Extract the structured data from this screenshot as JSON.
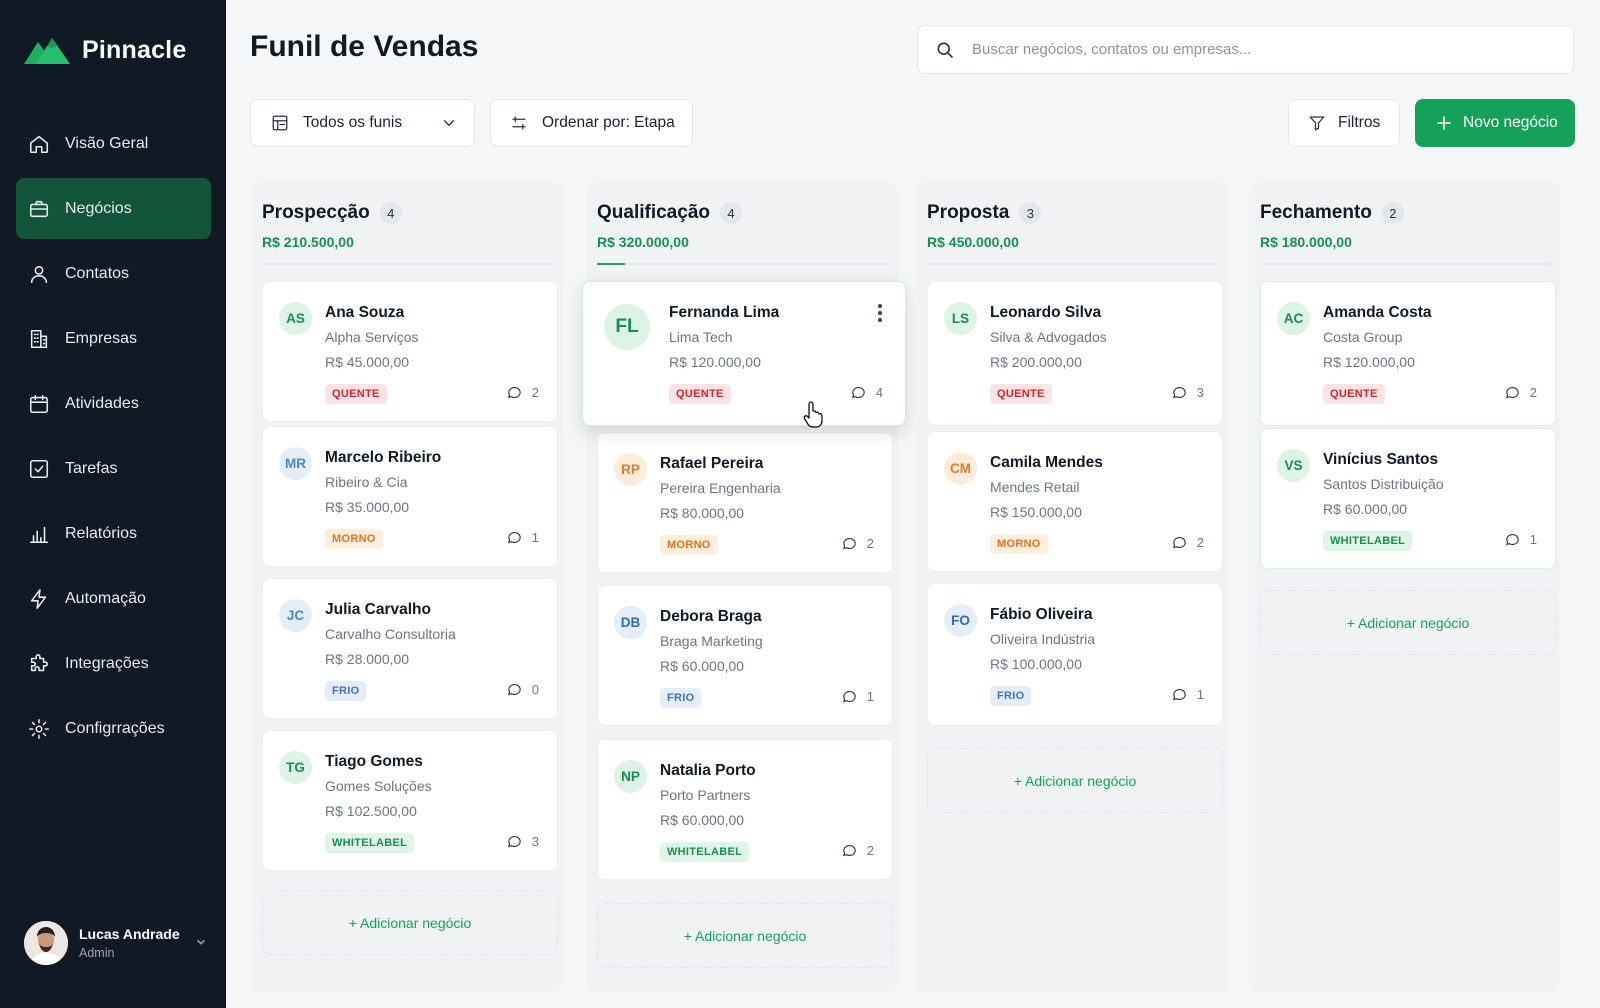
{
  "app": {
    "name": "Pinnacle",
    "brand_color": "#15a15a",
    "sidebar_bg": "#0f1a24"
  },
  "nav": [
    {
      "label": "Visão Geral",
      "icon": "home-icon",
      "active": false
    },
    {
      "label": "Negócios",
      "icon": "briefcase-icon",
      "active": true
    },
    {
      "label": "Contatos",
      "icon": "user-icon",
      "active": false
    },
    {
      "label": "Empresas",
      "icon": "building-icon",
      "active": false
    },
    {
      "label": "Atividades",
      "icon": "calendar-icon",
      "active": false
    },
    {
      "label": "Tarefas",
      "icon": "checkbox-icon",
      "active": false
    },
    {
      "label": "Relatórios",
      "icon": "bar-chart-icon",
      "active": false
    },
    {
      "label": "Automação",
      "icon": "lightning-icon",
      "active": false
    },
    {
      "label": "Integrações",
      "icon": "puzzle-icon",
      "active": false
    },
    {
      "label": "Configrrações",
      "icon": "gear-icon",
      "active": false
    }
  ],
  "user": {
    "name": "Lucas Andrade",
    "role": "Admin"
  },
  "header": {
    "title": "Funil de Vendas",
    "search_placeholder": "Buscar negócios, contatos ou empresas...",
    "funnel_select": "Todos os funis",
    "sort_label": "Ordenar por: Etapa",
    "filters_label": "Filtros",
    "new_deal_label": "Novo negócio"
  },
  "add_label": "+ Adicionar negócio",
  "columns": [
    {
      "title": "Prospecção",
      "count": "4",
      "total": "R$ 210.500,00",
      "cards": [
        {
          "initials": "AS",
          "name": "Ana Souza",
          "company": "Alpha Serviços",
          "value": "R$ 45.000,00",
          "tag": "QUENTE",
          "comments": "2"
        },
        {
          "initials": "MR",
          "name": "Marcelo Ribeiro",
          "company": "Ribeiro & Cia",
          "value": "R$ 35.000,00",
          "tag": "MORNO",
          "comments": "1"
        },
        {
          "initials": "JC",
          "name": "Julia Carvalho",
          "company": "Carvalho Consultoria",
          "value": "R$ 28.000,00",
          "tag": "FRIO",
          "comments": "0"
        },
        {
          "initials": "TG",
          "name": "Tiago Gomes",
          "company": "Gomes Soluções",
          "value": "R$ 102.500,00",
          "tag": "WHITELABEL",
          "comments": "3"
        }
      ]
    },
    {
      "title": "Qualificação",
      "count": "4",
      "total": "R$ 320.000,00",
      "cards": [
        {
          "initials": "FL",
          "name": "Fernanda Lima",
          "company": "Lima Tech",
          "value": "R$ 120.000,00",
          "tag": "QUENTE",
          "comments": "4"
        },
        {
          "initials": "RP",
          "name": "Rafael Pereira",
          "company": "Pereira Engenharia",
          "value": "R$ 80.000,00",
          "tag": "MORNO",
          "comments": "2"
        },
        {
          "initials": "DB",
          "name": "Debora Braga",
          "company": "Braga Marketing",
          "value": "R$ 60.000,00",
          "tag": "FRIO",
          "comments": "1"
        },
        {
          "initials": "NP",
          "name": "Natalia Porto",
          "company": "Porto Partners",
          "value": "R$ 60.000,00",
          "tag": "WHITELABEL",
          "comments": "2"
        }
      ]
    },
    {
      "title": "Proposta",
      "count": "3",
      "total": "R$ 450.000,00",
      "cards": [
        {
          "initials": "LS",
          "name": "Leonardo Silva",
          "company": "Silva & Advogados",
          "value": "R$ 200.000,00",
          "tag": "QUENTE",
          "comments": "3"
        },
        {
          "initials": "CM",
          "name": "Camila Mendes",
          "company": "Mendes Retail",
          "value": "R$ 150.000,00",
          "tag": "MORNO",
          "comments": "2"
        },
        {
          "initials": "FO",
          "name": "Fábio Oliveira",
          "company": "Oliveira Indústria",
          "value": "R$ 100.000,00",
          "tag": "FRIO",
          "comments": "1"
        }
      ]
    },
    {
      "title": "Fechamento",
      "count": "2",
      "total": "R$ 180.000,00",
      "cards": [
        {
          "initials": "AC",
          "name": "Amanda Costa",
          "company": "Costa Group",
          "value": "R$ 120.000,00",
          "tag": "QUENTE",
          "comments": "2"
        },
        {
          "initials": "VS",
          "name": "Vinícius Santos",
          "company": "Santos Distribuição",
          "value": "R$ 60.000,00",
          "tag": "WHITELABEL",
          "comments": "1"
        }
      ]
    }
  ]
}
